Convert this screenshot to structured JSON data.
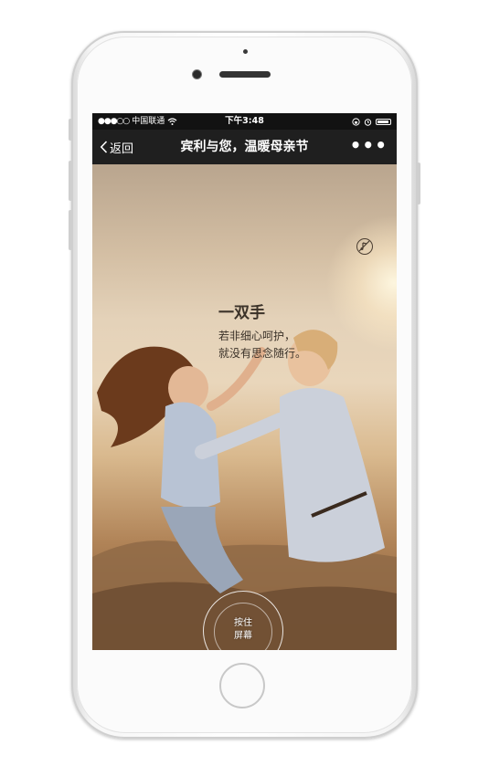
{
  "statusbar": {
    "signal": "●●●○○",
    "carrier": "中国联通",
    "time": "下午3:48"
  },
  "navbar": {
    "back_label": "返回",
    "title": "宾利与您，温暖母亲节",
    "more_label": "•••"
  },
  "content": {
    "caption_title": "一双手",
    "caption_line1": "若非细心呵护，",
    "caption_line2": "就没有思念随行。",
    "fingerprint_line1": "按住",
    "fingerprint_line2": "屏幕"
  },
  "icons": {
    "wifi": "wifi-icon",
    "back": "chevron-left-icon",
    "music": "music-off-icon",
    "fingerprint": "fingerprint-icon",
    "lock": "orientation-lock-icon",
    "alarm": "alarm-icon",
    "battery": "battery-icon"
  },
  "colors": {
    "navbar": "#1f1f1f",
    "statusbar": "#121212",
    "caption_text": "#3b3229"
  }
}
